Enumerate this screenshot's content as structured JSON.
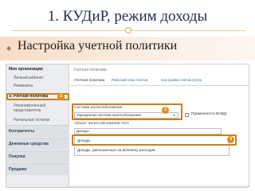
{
  "slide": {
    "title": "1. КУДиР, режим доходы",
    "section_heading": "Настройка учетной политики"
  },
  "sidebar": {
    "org_heading": "Моя организация",
    "items": [
      {
        "label": "Личный кабинет",
        "kind": "sub"
      },
      {
        "label": "Реквизиты",
        "kind": "sub"
      },
      {
        "label": "Учетная политика",
        "kind": "active"
      },
      {
        "label": "Уполномоченный",
        "kind": "sub"
      },
      {
        "label": "представитель",
        "kind": "sub"
      },
      {
        "label": "Начальные остатки",
        "kind": "sub"
      }
    ],
    "groups": [
      "Контрагенты",
      "Денежные средства",
      "Покупки",
      "Продажи"
    ]
  },
  "main": {
    "header": "Учетная политика",
    "tabs": [
      "Учетная политика",
      "Рабочий план счетов",
      "Настройка счетов учета"
    ],
    "tax_system_label": "Система налогообложения",
    "tax_system_value": "Упрощенная система налогообложения",
    "envd_label": "Применяется ЕНВД",
    "usn_object_label": "Объект налогообложения УСН",
    "usn_object_value": "Доходы",
    "dropdown_options": [
      "Доходы",
      "Доходы, уменьшенные на величину расходов"
    ]
  },
  "badges": [
    "1",
    "2",
    "3"
  ],
  "colors": {
    "highlight": "#c8801c",
    "badge": "#e08a1c",
    "title": "#1f2d4a",
    "band": "#f7ddc7"
  }
}
